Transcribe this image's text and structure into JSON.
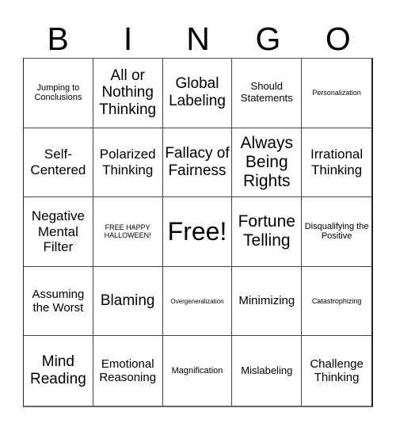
{
  "header": {
    "letters": [
      "B",
      "I",
      "N",
      "G",
      "O"
    ]
  },
  "board": {
    "cells": [
      "Jumping to Conclusions",
      "All or Nothing Thinking",
      "Global Labeling",
      "Should Statements",
      "Personalization",
      "Self-Centered",
      "Polarized Thinking",
      "Fallacy of Fairness",
      "Always Being Rights",
      "Irrational Thinking",
      "Negative Mental Filter",
      "FREE HAPPY HALLOWEEN!",
      "Free!",
      "Fortune Telling",
      "Disqualifying the Positive",
      "Assuming the Worst",
      "Blaming",
      "Overgeneralization",
      "Minimizing",
      "Catastrophizing",
      "Mind Reading",
      "Emotional Reasoning",
      "Magnification",
      "Mislabeling",
      "Challenge Thinking"
    ]
  }
}
